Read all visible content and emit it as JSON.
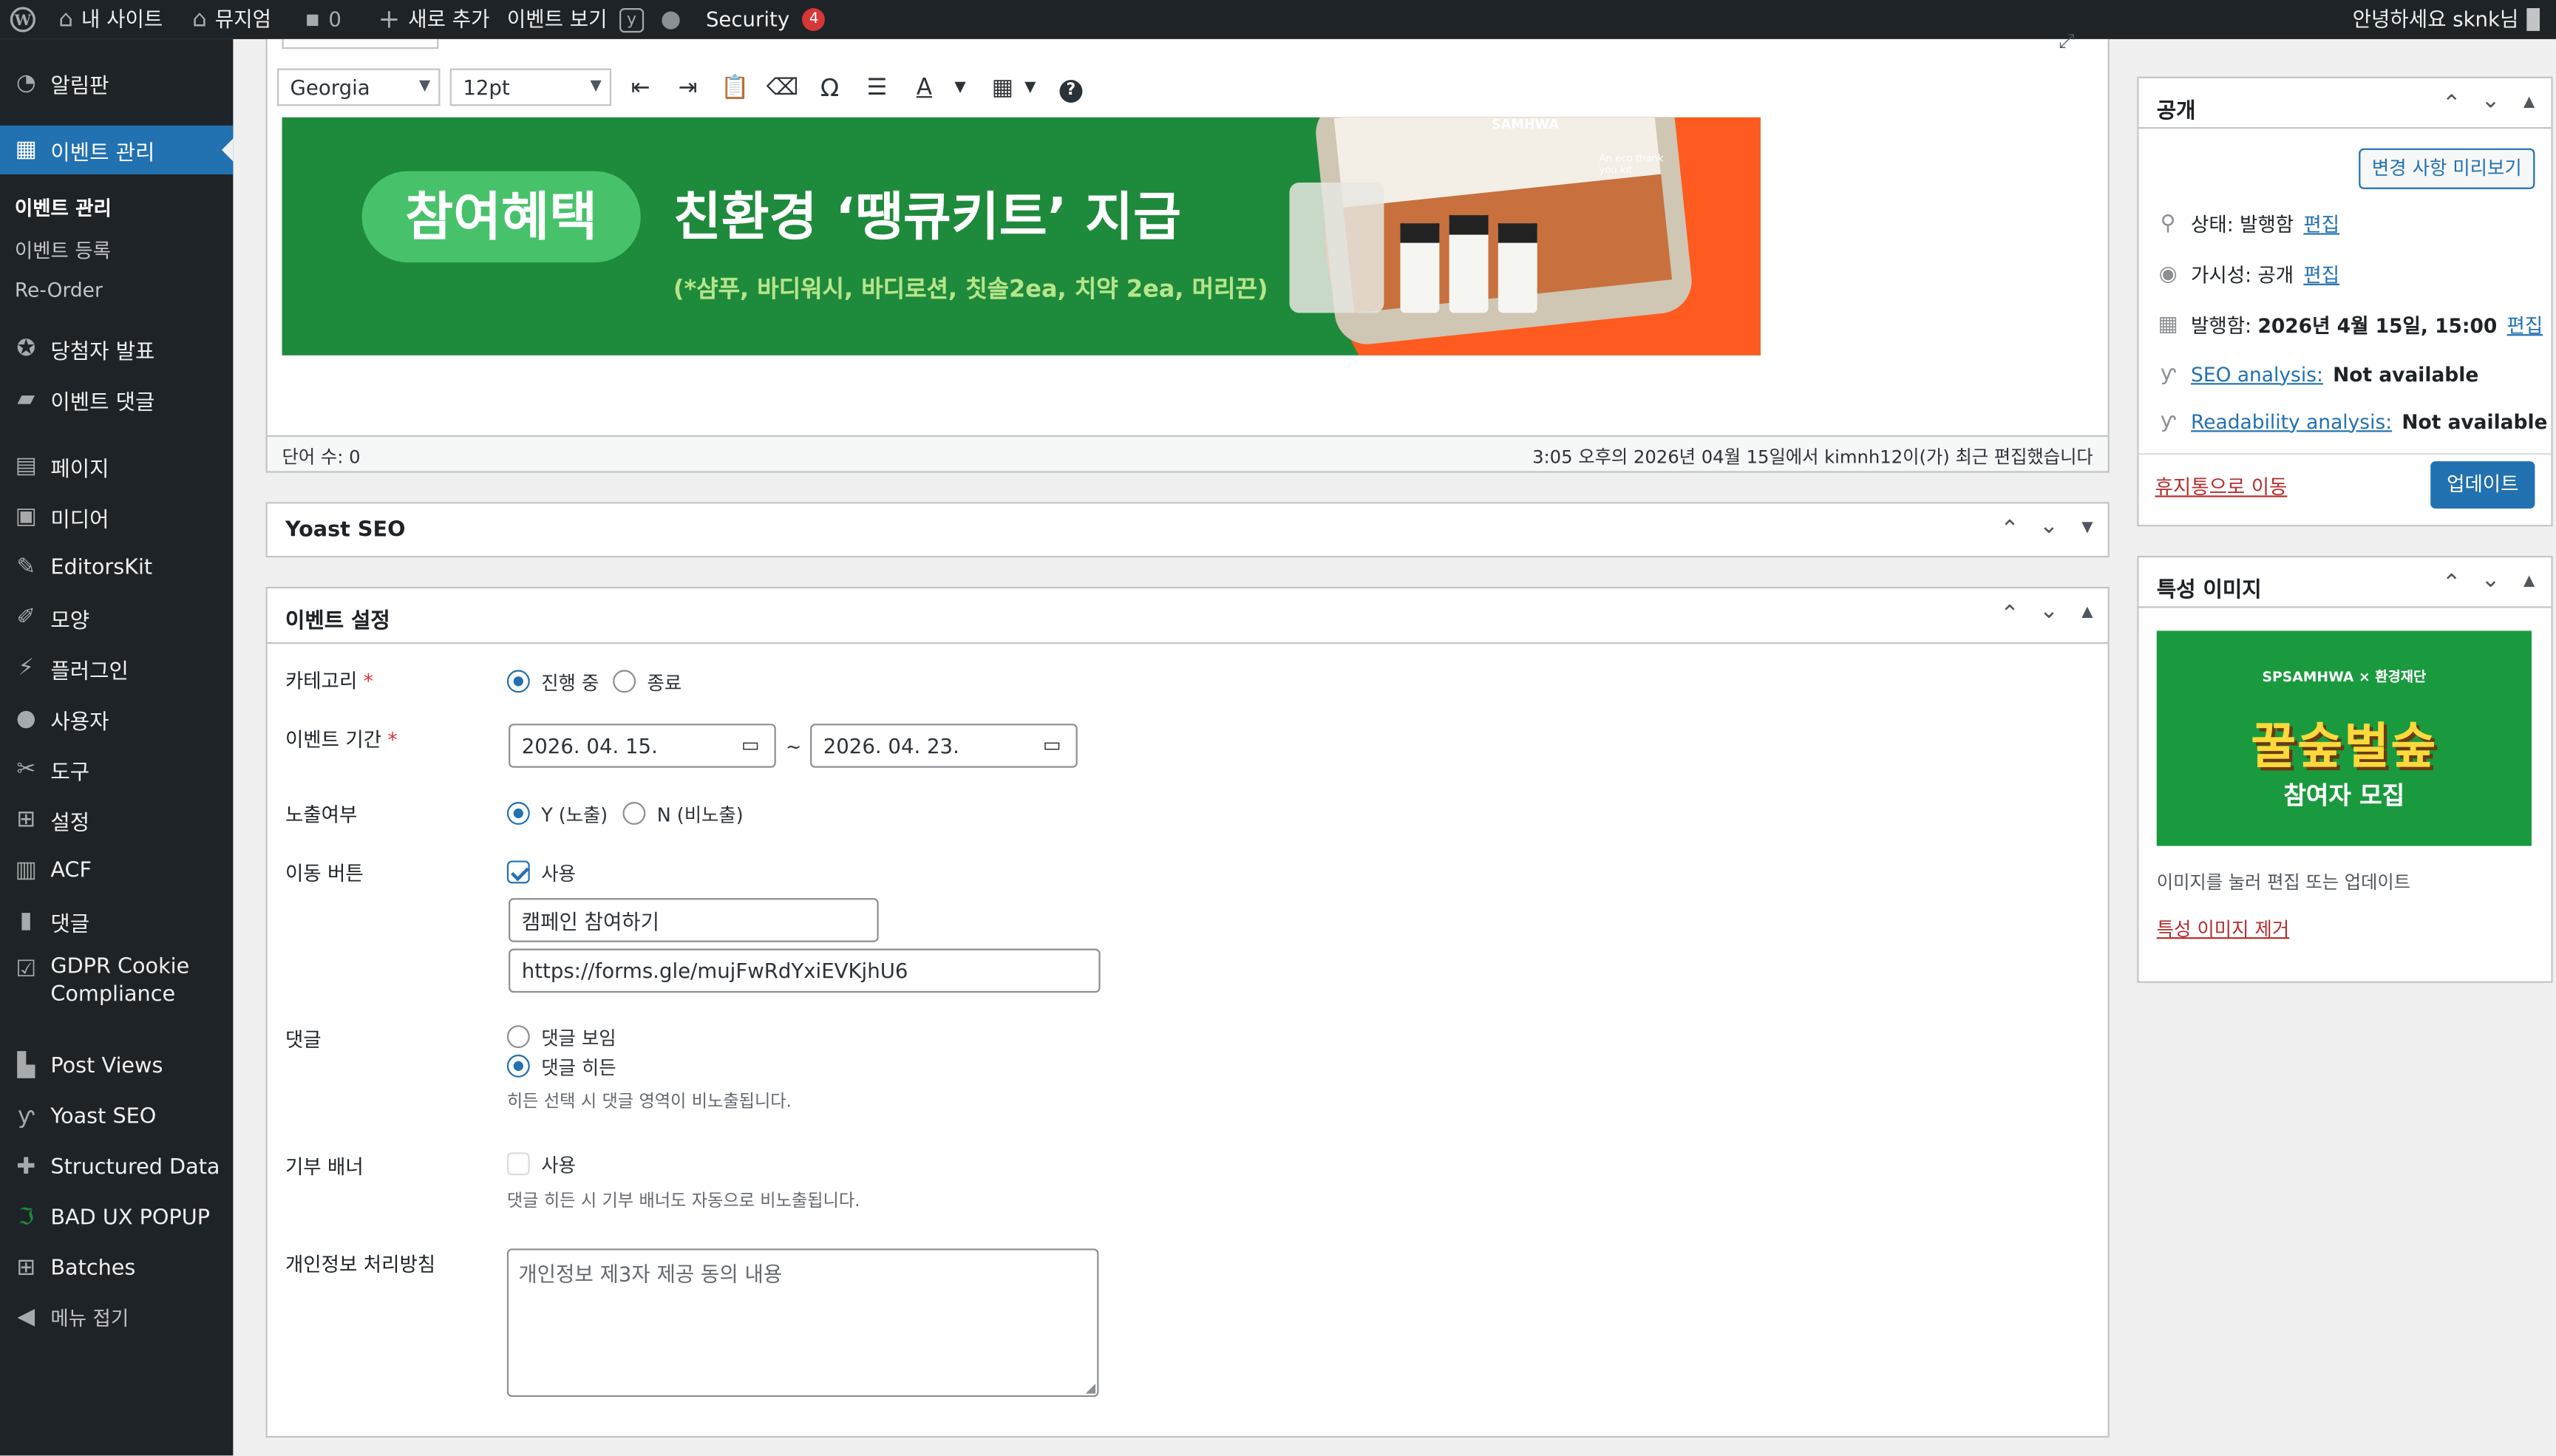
{
  "adminbar": {
    "site_name": "내 사이트",
    "museum": "뮤지엄",
    "comments_count": "0",
    "new": "새로 추가",
    "view_event": "이벤트 보기",
    "security": "Security",
    "security_count": "4",
    "greeting": "안녕하세요 sknk님"
  },
  "sidebar": {
    "dashboard": "알림판",
    "event_manage": "이벤트 관리",
    "sub_event_manage": "이벤트 관리",
    "sub_event_register": "이벤트 등록",
    "sub_reorder": "Re-Order",
    "winners": "당첨자 발표",
    "event_comments": "이벤트 댓글",
    "pages": "페이지",
    "media": "미디어",
    "editorskit": "EditorsKit",
    "appearance": "모양",
    "plugins": "플러그인",
    "users": "사용자",
    "tools": "도구",
    "settings": "설정",
    "acf": "ACF",
    "comments": "댓글",
    "gdpr": "GDPR Cookie Compliance",
    "post_views": "Post Views",
    "yoast": "Yoast SEO",
    "structured": "Structured Data",
    "bad_ux": "BAD UX POPUP",
    "batches": "Batches",
    "collapse": "메뉴 접기"
  },
  "editor": {
    "font_family": "Georgia",
    "font_size": "12pt",
    "banner": {
      "pill": "참여혜택",
      "headline": "친환경 ‘땡큐키트’ 지급",
      "sub": "(*샴푸, 바디워시, 바디로션, 칫솔2ea, 치약 2ea, 머리끈)",
      "kit_text": "An eco thank you kit",
      "brand_text": "SAMHWA"
    },
    "word_count": "단어 수: 0",
    "last_edited": "3:05 오후의 2026년 04월 15일에서 kimnh12이(가) 최근 편집했습니다"
  },
  "yoast_box": {
    "title": "Yoast SEO"
  },
  "event_settings": {
    "title": "이벤트 설정",
    "category_label": "카테고리",
    "cat_ongoing": "진행 중",
    "cat_ended": "종료",
    "period_label": "이벤트 기간",
    "date_start": "2026. 04. 15.",
    "date_sep": "~",
    "date_end": "2026. 04. 23.",
    "exposure_label": "노출여부",
    "exp_yes": "Y (노출)",
    "exp_no": "N (비노출)",
    "move_btn_label": "이동 버튼",
    "move_use": "사용",
    "move_btn_text": "캠페인 참여하기",
    "move_btn_url": "https://forms.gle/mujFwRdYxiEVKjhU6",
    "comment_label": "댓글",
    "comment_show": "댓글 보임",
    "comment_hide": "댓글 히든",
    "comment_help": "히든 선택 시 댓글 영역이 비노출됩니다.",
    "donate_label": "기부 배너",
    "donate_use": "사용",
    "donate_help": "댓글 히든 시 기부 배너도 자동으로 비노출됩니다.",
    "privacy_label": "개인정보 처리방침",
    "privacy_placeholder": "개인정보 제3자 제공 동의 내용"
  },
  "publish": {
    "title": "공개",
    "preview_btn": "변경 사항 미리보기",
    "status": "상태: 발행함",
    "visibility": "가시성: 공개",
    "published_prefix": "발행함: ",
    "published_date": "2026년 4월 15일, 15:00",
    "edit": "편집",
    "seo_link": "SEO analysis:",
    "seo_value": "Not available",
    "read_link": "Readability analysis:",
    "read_value": "Not available",
    "trash": "휴지통으로 이동",
    "update": "업데이트"
  },
  "featured": {
    "title": "특성 이미지",
    "img_brand": "SPSAMHWA × 환경재단",
    "img_title": "꿀숲벌숲",
    "img_sub": "참여자 모집",
    "hint": "이미지를 눌러 편집 또는 업데이트",
    "remove": "특성 이미지 제거"
  },
  "colors": {
    "admin_dark": "#1d2327",
    "accent": "#2271b1",
    "banner_green": "#1e8a3b",
    "banner_orange": "#ff5a1f"
  }
}
